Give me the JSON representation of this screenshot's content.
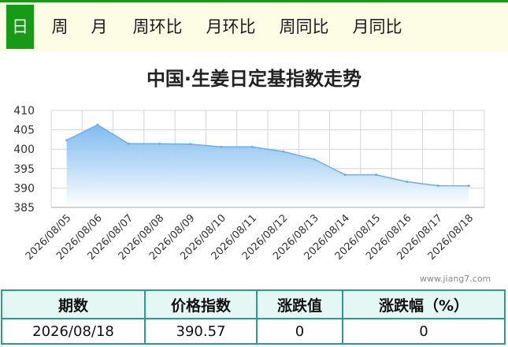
{
  "tabs": [
    {
      "label": "日",
      "active": true
    },
    {
      "label": "周",
      "active": false
    },
    {
      "label": "月",
      "active": false
    },
    {
      "label": "周环比",
      "active": false
    },
    {
      "label": "月环比",
      "active": false
    },
    {
      "label": "周同比",
      "active": false
    },
    {
      "label": "月同比",
      "active": false
    }
  ],
  "watermark": "www.jiang7.com",
  "chart_data": {
    "type": "area",
    "title": "中国·生姜日定基指数走势",
    "xlabel": "",
    "ylabel": "",
    "x": [
      "2026/08/05",
      "2026/08/06",
      "2026/08/07",
      "2026/08/08",
      "2026/08/09",
      "2026/08/10",
      "2026/08/11",
      "2026/08/12",
      "2026/08/13",
      "2026/08/14",
      "2026/08/15",
      "2026/08/16",
      "2026/08/17",
      "2026/08/18"
    ],
    "values": [
      402.3,
      406.3,
      401.4,
      401.4,
      401.3,
      400.6,
      400.6,
      399.4,
      397.4,
      393.4,
      393.4,
      391.6,
      390.6,
      390.57
    ],
    "ylim": [
      385,
      410
    ],
    "yticks": [
      385,
      390,
      395,
      400,
      405,
      410
    ],
    "grid": true,
    "colors": {
      "line": "#6aaeea",
      "fill_top": "#79b8ee",
      "fill_bottom": "#ffffff",
      "grid": "#d5d5d5"
    }
  },
  "table": {
    "headers": [
      "期数",
      "价格指数",
      "涨跌值",
      "涨跌幅（%）"
    ],
    "row": [
      "2026/08/18",
      "390.57",
      "0",
      "0"
    ]
  },
  "colors": {
    "accent": "#179b17",
    "table_border": "#2a9d8f",
    "table_header_bg": "#e4f7f4"
  }
}
